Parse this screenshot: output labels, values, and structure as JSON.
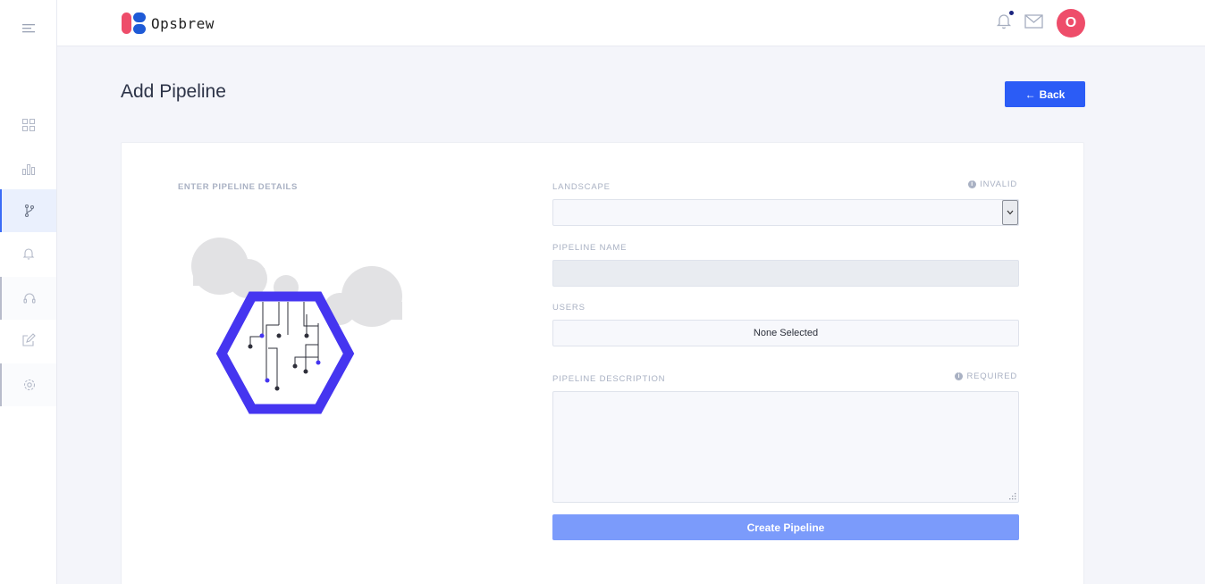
{
  "app": {
    "name": "Opsbrew",
    "avatar_initial": "O",
    "accent": "#2b5cf6",
    "avatar_color": "#ee4d6a"
  },
  "sidebar": {
    "items": [
      {
        "icon": "grid-icon"
      },
      {
        "icon": "bar-chart-icon"
      },
      {
        "icon": "branch-icon",
        "active": true
      },
      {
        "icon": "bell-icon"
      },
      {
        "icon": "headset-icon"
      },
      {
        "icon": "edit-icon"
      },
      {
        "icon": "settings-icon"
      }
    ]
  },
  "header": {
    "icons": [
      "bell-icon",
      "mail-icon"
    ]
  },
  "page": {
    "title": "Add Pipeline",
    "back_label": "Back"
  },
  "form": {
    "section_title": "ENTER PIPELINE DETAILS",
    "landscape": {
      "label": "LANDSCAPE",
      "status": "INVALID",
      "value": ""
    },
    "pipeline_name": {
      "label": "PIPELINE NAME",
      "value": ""
    },
    "users": {
      "label": "USERS",
      "value": "None Selected"
    },
    "description": {
      "label": "PIPELINE DESCRIPTION",
      "status": "REQUIRED",
      "value": ""
    },
    "submit_label": "Create Pipeline"
  }
}
